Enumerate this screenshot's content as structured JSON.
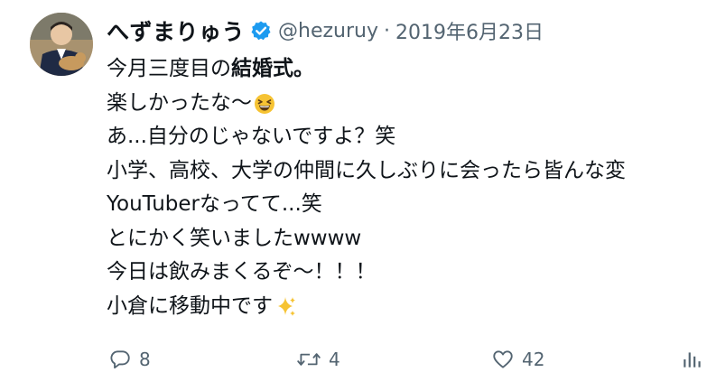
{
  "tweet": {
    "display_name": "へずまりゅう",
    "handle": "@hezuruy",
    "separator": "·",
    "date": "2019年6月23日",
    "avatar_icon": "user-avatar-photo",
    "verified_icon": "verified-badge-icon",
    "verified_color": "#1d9bf0",
    "lines": [
      {
        "pre": "今月三度目の",
        "bold": "結婚式。",
        "post": ""
      },
      {
        "pre": "楽しかったな〜",
        "bold": "",
        "post": "",
        "emoji": "grinning-squinting-face-emoji"
      },
      {
        "pre": "あ...自分のじゃないですよ？笑",
        "bold": "",
        "post": ""
      },
      {
        "pre": "小学、高校、大学の仲間に久しぶりに会ったら皆んな変",
        "bold": "",
        "post": ""
      },
      {
        "pre": "YouTuberなってて...笑",
        "bold": "",
        "post": ""
      },
      {
        "pre": "とにかく笑いましたwwww",
        "bold": "",
        "post": ""
      },
      {
        "pre": "今日は飲みまくるぞ〜！！！",
        "bold": "",
        "post": ""
      },
      {
        "pre": "小倉に移動中です",
        "bold": "",
        "post": "",
        "emoji": "sparkles-emoji"
      }
    ]
  },
  "actions": {
    "reply": {
      "icon": "reply-icon",
      "count": "8"
    },
    "retweet": {
      "icon": "retweet-icon",
      "count": "4"
    },
    "like": {
      "icon": "like-heart-icon",
      "count": "42"
    },
    "stats": {
      "icon": "analytics-icon"
    }
  },
  "colors": {
    "text": "#0f1419",
    "muted": "#536471",
    "emoji_yellow": "#f6c333"
  }
}
